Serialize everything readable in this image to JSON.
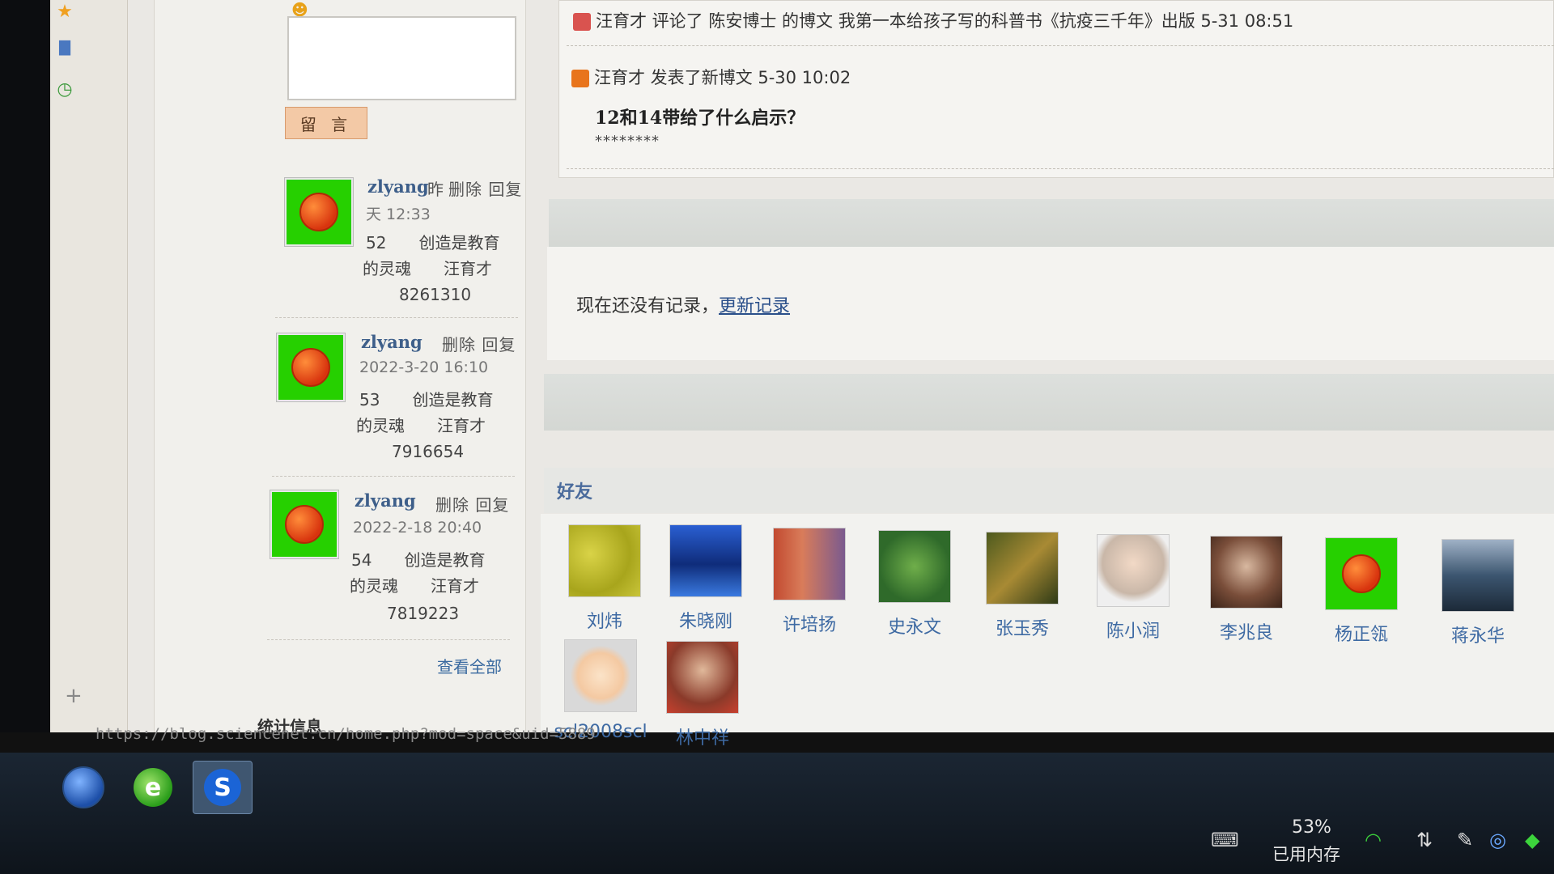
{
  "left_panel": {
    "message_button": "留 言",
    "comments": [
      {
        "author": "zlyang",
        "ops": "删除 回复",
        "time_line1": "昨",
        "time_line2": "天 12:33",
        "body_line1": "52　　创造是教育",
        "body_line2": "的灵魂　　汪育才",
        "body_line3": "8261310"
      },
      {
        "author": "zlyang",
        "ops": "删除 回复",
        "time": "2022-3-20 16:10",
        "body_line1": "53　　创造是教育",
        "body_line2": "的灵魂　　汪育才",
        "body_line3": "7916654"
      },
      {
        "author": "zlyang",
        "ops": "删除 回复",
        "time": "2022-2-18 20:40",
        "body_line1": "54　　创造是教育",
        "body_line2": "的灵魂　　汪育才",
        "body_line3": "7819223"
      }
    ],
    "view_all": "查看全部",
    "stats_title": "统计信息"
  },
  "feed": {
    "line1": "汪育才 评论了 陈安博士 的博文 我第一本给孩子写的科普书《抗疫三千年》出版 5-31 08:51",
    "line2": "汪育才 发表了新博文 5-30 10:02",
    "post_title": "12和14带给了什么启示？",
    "post_excerpt": "********"
  },
  "records": {
    "text": "现在还没有记录，",
    "link": "更新记录"
  },
  "friends": {
    "title": "好友",
    "list": [
      {
        "name": "刘炜",
        "icon": "yellow-moss-avatar"
      },
      {
        "name": "朱晓刚",
        "icon": "blue-water-avatar"
      },
      {
        "name": "许培扬",
        "icon": "man-at-podium-avatar"
      },
      {
        "name": "史永文",
        "icon": "green-leaf-avatar"
      },
      {
        "name": "张玉秀",
        "icon": "bird-on-branch-avatar"
      },
      {
        "name": "陈小润",
        "icon": "woman-with-glasses-avatar"
      },
      {
        "name": "李兆良",
        "icon": "older-man-portrait-avatar"
      },
      {
        "name": "杨正瓴",
        "icon": "green-apple-avatar"
      },
      {
        "name": "蒋永华",
        "icon": "sea-waves-avatar"
      },
      {
        "name": "scl2008scl",
        "icon": "cartoon-boy-avatar"
      },
      {
        "name": "林中祥",
        "icon": "man-portrait-avatar"
      }
    ]
  },
  "status_url": "https://blog.sciencenet.cn/home.php?mod=space&uid=5889",
  "tray": {
    "memory_percent": "53%",
    "memory_label": "已用内存"
  }
}
